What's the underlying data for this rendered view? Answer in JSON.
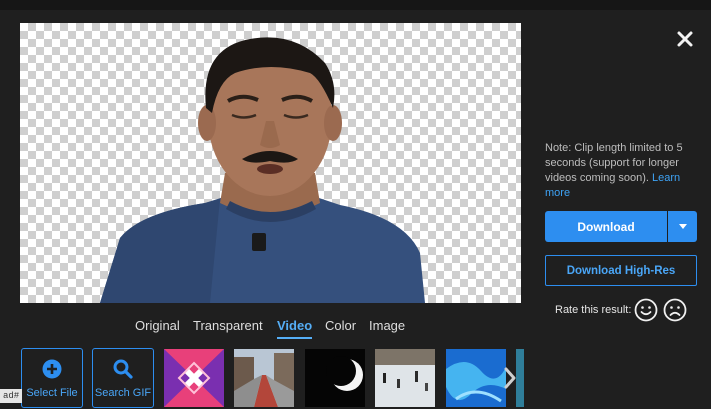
{
  "close_label": "close",
  "note": {
    "text": "Note: Clip length limited to 5 seconds (support for longer videos coming soon). ",
    "link": "Learn more"
  },
  "download": {
    "label": "Download"
  },
  "download_hires": {
    "label": "Download High-Res"
  },
  "rating": {
    "label": "Rate this result:"
  },
  "tabs": [
    {
      "label": "Original"
    },
    {
      "label": "Transparent"
    },
    {
      "label": "Video",
      "active": true
    },
    {
      "label": "Color"
    },
    {
      "label": "Image"
    }
  ],
  "tools": {
    "select_file": "Select File",
    "search_gif": "Search GIF"
  },
  "corner_tag": "ad#",
  "colors": {
    "accent": "#2d8ef0",
    "background": "#1f1f1f"
  }
}
